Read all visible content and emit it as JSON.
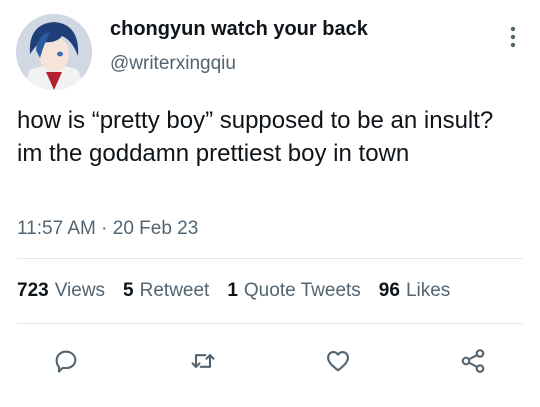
{
  "author": {
    "display_name": "chongyun watch your back",
    "handle": "@writerxingqiu",
    "avatar_icon": "anime-avatar"
  },
  "tweet": {
    "text": "how is “pretty boy” supposed to be an insult? im the goddamn prettiest boy in town",
    "timestamp": "11:57 AM · 20 Feb 23"
  },
  "stats": {
    "views_count": "723",
    "views_label": "Views",
    "retweets_count": "5",
    "retweets_label": "Retweet",
    "quotes_count": "1",
    "quotes_label": "Quote Tweets",
    "likes_count": "96",
    "likes_label": "Likes"
  },
  "actions": [
    "reply-icon",
    "retweet-icon",
    "like-icon",
    "share-icon"
  ],
  "colors": {
    "text": "#0f1419",
    "secondary": "#536471",
    "divider": "#e6e9ec"
  }
}
